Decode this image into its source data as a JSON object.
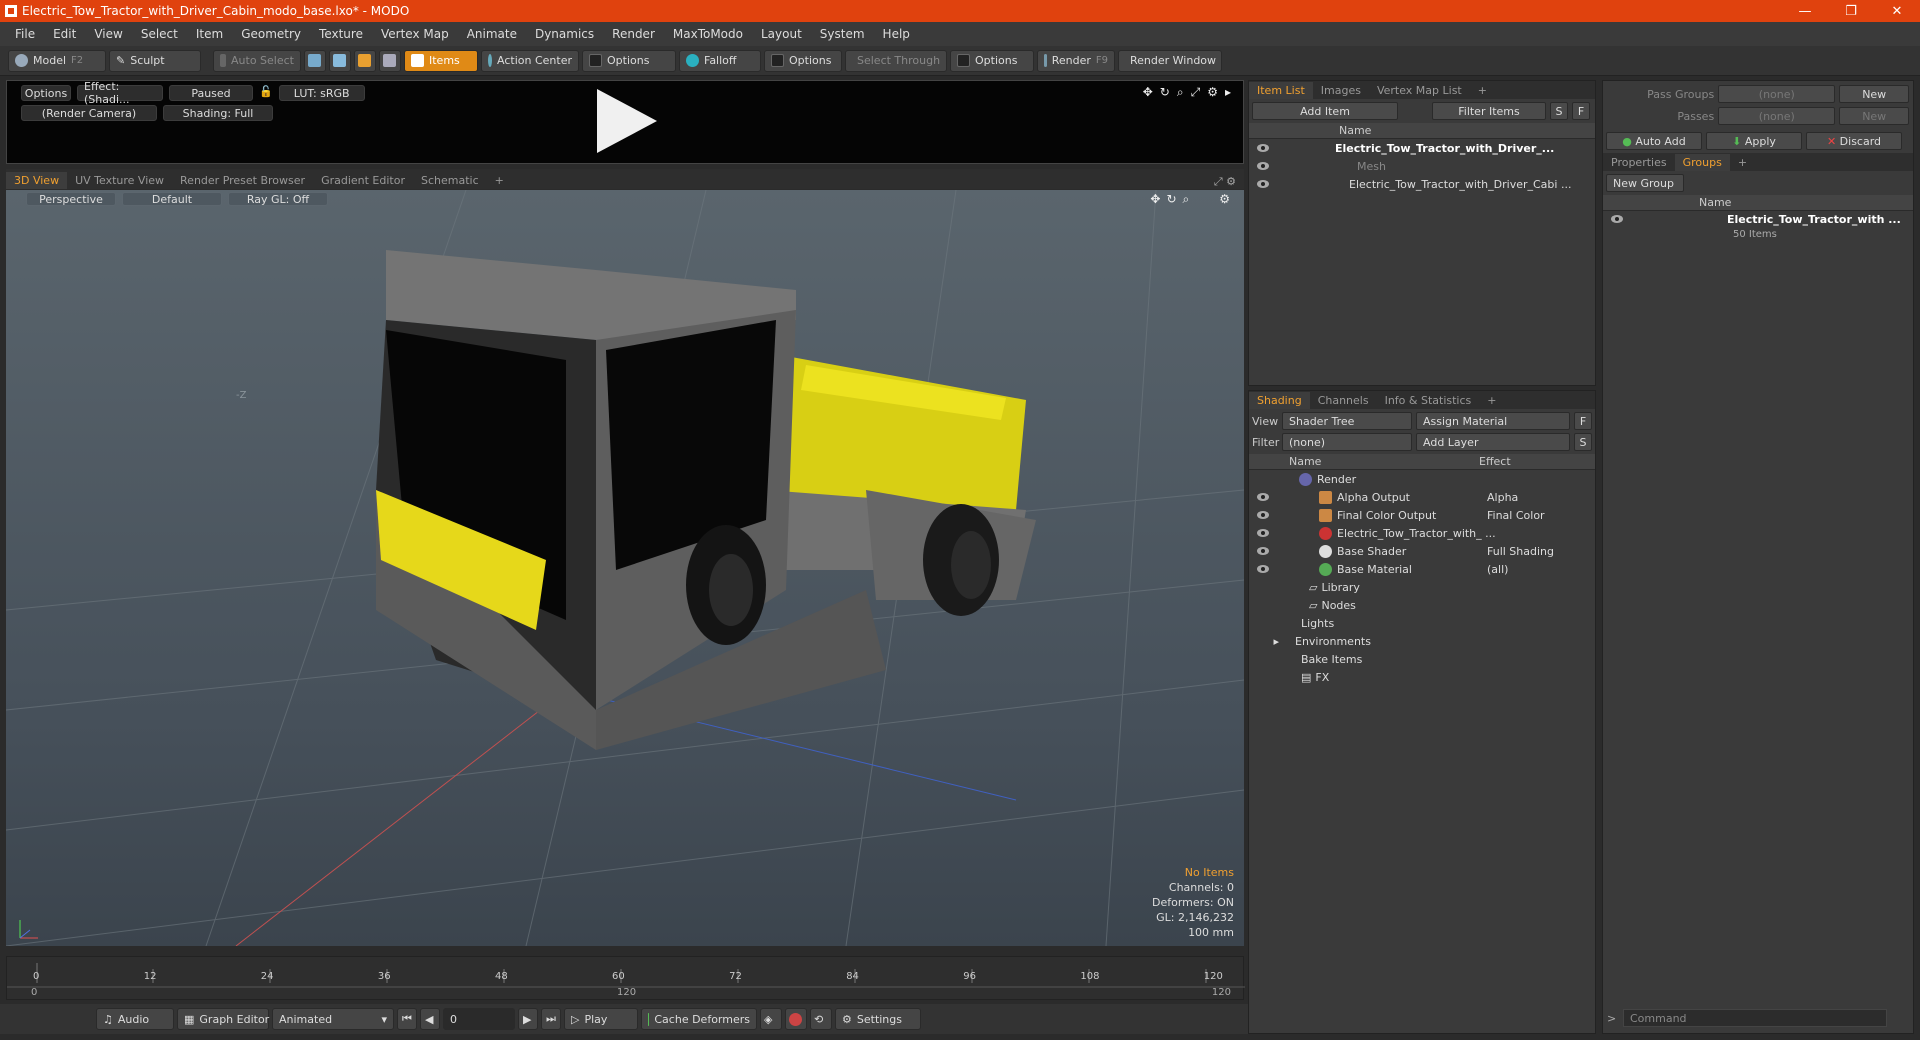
{
  "window": {
    "title": "Electric_Tow_Tractor_with_Driver_Cabin_modo_base.lxo* - MODO",
    "controls": [
      "—",
      "❐",
      "✕"
    ]
  },
  "menu": [
    "File",
    "Edit",
    "View",
    "Select",
    "Item",
    "Geometry",
    "Texture",
    "Vertex Map",
    "Animate",
    "Dynamics",
    "Render",
    "MaxToModo",
    "Layout",
    "System",
    "Help"
  ],
  "toolbar": {
    "model": "Model",
    "model_key": "F2",
    "sculpt": "Sculpt",
    "auto_select": "Auto Select",
    "items": "Items",
    "action_center": "Action Center",
    "options1": "Options",
    "falloff": "Falloff",
    "options2": "Options",
    "select_through": "Select Through",
    "options3": "Options",
    "render": "Render",
    "render_key": "F9",
    "render_window": "Render Window"
  },
  "preview": {
    "options": "Options",
    "effect": "Effect: (Shadi...",
    "paused": "Paused",
    "lut": "LUT: sRGB",
    "camera": "(Render Camera)",
    "shading": "Shading: Full"
  },
  "view_tabs": [
    "3D View",
    "UV Texture View",
    "Render Preset Browser",
    "Gradient Editor",
    "Schematic",
    "+"
  ],
  "viewport": {
    "perspective": "Perspective",
    "default": "Default",
    "raygl": "Ray GL: Off",
    "axis_label": "-Z",
    "stats": [
      "No Items",
      "Channels: 0",
      "Deformers: ON",
      "GL: 2,146,232",
      "100 mm"
    ]
  },
  "timeline": {
    "ticks": [
      "0",
      "12",
      "24",
      "36",
      "48",
      "60",
      "72",
      "84",
      "96",
      "108",
      "120"
    ],
    "start": "0",
    "mid": "120",
    "end": "120"
  },
  "bottom": {
    "audio": "Audio",
    "graph_editor": "Graph Editor",
    "animated": "Animated",
    "frame": "0",
    "play": "Play",
    "cache": "Cache Deformers",
    "settings": "Settings"
  },
  "itemlist": {
    "tabs": [
      "Item List",
      "Images",
      "Vertex Map List",
      "+"
    ],
    "add_item": "Add Item",
    "filter_items": "Filter Items",
    "s": "S",
    "f": "F",
    "col_name": "Name",
    "rows": [
      "Electric_Tow_Tractor_with_Driver_...",
      "Mesh",
      "Electric_Tow_Tractor_with_Driver_Cabi ..."
    ]
  },
  "shading": {
    "tabs": [
      "Shading",
      "Channels",
      "Info & Statistics",
      "+"
    ],
    "view_label": "View",
    "view_value": "Shader Tree",
    "assign": "Assign Material",
    "f": "F",
    "filter_label": "Filter",
    "filter_value": "(none)",
    "add_layer": "Add Layer",
    "s": "S",
    "col_name": "Name",
    "col_effect": "Effect",
    "rows": [
      {
        "name": "Render",
        "effect": ""
      },
      {
        "name": "Alpha Output",
        "effect": "Alpha"
      },
      {
        "name": "Final Color Output",
        "effect": "Final Color"
      },
      {
        "name": "Electric_Tow_Tractor_with_ ...",
        "effect": ""
      },
      {
        "name": "Base Shader",
        "effect": "Full Shading"
      },
      {
        "name": "Base Material",
        "effect": "(all)"
      },
      {
        "name": "Library",
        "effect": ""
      },
      {
        "name": "Nodes",
        "effect": ""
      },
      {
        "name": "Lights",
        "effect": ""
      },
      {
        "name": "Environments",
        "effect": ""
      },
      {
        "name": "Bake Items",
        "effect": ""
      },
      {
        "name": "FX",
        "effect": ""
      }
    ]
  },
  "groups": {
    "pass_groups": "Pass Groups",
    "passes": "Passes",
    "none": "(none)",
    "new": "New",
    "auto_add": "Auto Add",
    "apply": "Apply",
    "discard": "Discard",
    "tabs": [
      "Properties",
      "Groups",
      "+"
    ],
    "new_group": "New Group",
    "col_name": "Name",
    "group_name": "Electric_Tow_Tractor_with ...",
    "group_count": "50 Items",
    "command": "Command"
  },
  "colors": {
    "accent": "#f0a030",
    "titlebar": "#e0420e",
    "yellow": "#f2e01a"
  }
}
